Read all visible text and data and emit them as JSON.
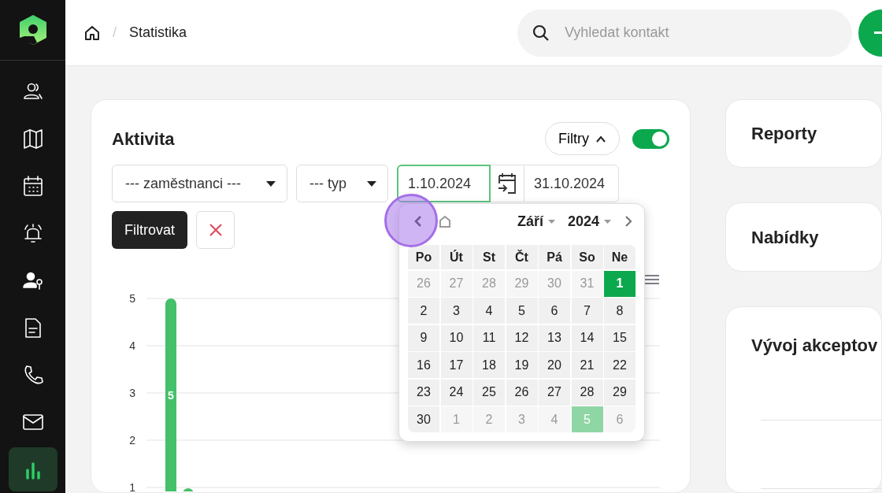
{
  "sidebar": {
    "items": [
      {
        "kind": "people",
        "selected": false
      },
      {
        "kind": "map",
        "selected": false
      },
      {
        "kind": "calendar",
        "selected": false
      },
      {
        "kind": "bell",
        "selected": false
      },
      {
        "kind": "user-key",
        "selected": false
      },
      {
        "kind": "document",
        "selected": false
      },
      {
        "kind": "phone",
        "selected": false
      },
      {
        "kind": "mail",
        "selected": false
      },
      {
        "kind": "chart",
        "selected": true
      }
    ]
  },
  "breadcrumb": {
    "separator": "/",
    "items": [
      "Statistika"
    ]
  },
  "search": {
    "placeholder": "Vyhledat kontakt"
  },
  "activity": {
    "title": "Aktivita",
    "filters_button": "Filtry",
    "filters_expanded": true,
    "toggle": {
      "on": true
    },
    "employee_select": "--- zaměstnanci ---",
    "type_select": "--- typ",
    "date_from": "1.10.2024",
    "date_to": "31.10.2024",
    "filter_button": "Filtrovat",
    "chart_data": {
      "type": "bar",
      "values": [
        5
      ],
      "ylim": [
        1,
        5
      ],
      "yticks": [
        1,
        2,
        3,
        4,
        5
      ],
      "grid": true,
      "value_labels": [
        "5"
      ]
    }
  },
  "datepicker": {
    "month": "Září",
    "year": "2024",
    "weekdays": [
      "Po",
      "Út",
      "St",
      "Čt",
      "Pá",
      "So",
      "Ne"
    ],
    "days": [
      {
        "label": "26",
        "muted": true,
        "selected": false,
        "today": false
      },
      {
        "label": "27",
        "muted": true,
        "selected": false,
        "today": false
      },
      {
        "label": "28",
        "muted": true,
        "selected": false,
        "today": false
      },
      {
        "label": "29",
        "muted": true,
        "selected": false,
        "today": false
      },
      {
        "label": "30",
        "muted": true,
        "selected": false,
        "today": false
      },
      {
        "label": "31",
        "muted": true,
        "selected": false,
        "today": false
      },
      {
        "label": "1",
        "muted": false,
        "selected": true,
        "today": false
      },
      {
        "label": "2",
        "muted": false,
        "selected": false,
        "today": false
      },
      {
        "label": "3",
        "muted": false,
        "selected": false,
        "today": false
      },
      {
        "label": "4",
        "muted": false,
        "selected": false,
        "today": false
      },
      {
        "label": "5",
        "muted": false,
        "selected": false,
        "today": false
      },
      {
        "label": "6",
        "muted": false,
        "selected": false,
        "today": false
      },
      {
        "label": "7",
        "muted": false,
        "selected": false,
        "today": false
      },
      {
        "label": "8",
        "muted": false,
        "selected": false,
        "today": false
      },
      {
        "label": "9",
        "muted": false,
        "selected": false,
        "today": false
      },
      {
        "label": "10",
        "muted": false,
        "selected": false,
        "today": false
      },
      {
        "label": "11",
        "muted": false,
        "selected": false,
        "today": false
      },
      {
        "label": "12",
        "muted": false,
        "selected": false,
        "today": false
      },
      {
        "label": "13",
        "muted": false,
        "selected": false,
        "today": false
      },
      {
        "label": "14",
        "muted": false,
        "selected": false,
        "today": false
      },
      {
        "label": "15",
        "muted": false,
        "selected": false,
        "today": false
      },
      {
        "label": "16",
        "muted": false,
        "selected": false,
        "today": false
      },
      {
        "label": "17",
        "muted": false,
        "selected": false,
        "today": false
      },
      {
        "label": "18",
        "muted": false,
        "selected": false,
        "today": false
      },
      {
        "label": "19",
        "muted": false,
        "selected": false,
        "today": false
      },
      {
        "label": "20",
        "muted": false,
        "selected": false,
        "today": false
      },
      {
        "label": "21",
        "muted": false,
        "selected": false,
        "today": false
      },
      {
        "label": "22",
        "muted": false,
        "selected": false,
        "today": false
      },
      {
        "label": "23",
        "muted": false,
        "selected": false,
        "today": false
      },
      {
        "label": "24",
        "muted": false,
        "selected": false,
        "today": false
      },
      {
        "label": "25",
        "muted": false,
        "selected": false,
        "today": false
      },
      {
        "label": "26",
        "muted": false,
        "selected": false,
        "today": false
      },
      {
        "label": "27",
        "muted": false,
        "selected": false,
        "today": false
      },
      {
        "label": "28",
        "muted": false,
        "selected": false,
        "today": false
      },
      {
        "label": "29",
        "muted": false,
        "selected": false,
        "today": false
      },
      {
        "label": "30",
        "muted": false,
        "selected": false,
        "today": false
      },
      {
        "label": "1",
        "muted": true,
        "selected": false,
        "today": false
      },
      {
        "label": "2",
        "muted": true,
        "selected": false,
        "today": false
      },
      {
        "label": "3",
        "muted": true,
        "selected": false,
        "today": false
      },
      {
        "label": "4",
        "muted": true,
        "selected": false,
        "today": false
      },
      {
        "label": "5",
        "muted": true,
        "selected": false,
        "today": true
      },
      {
        "label": "6",
        "muted": true,
        "selected": false,
        "today": false
      }
    ]
  },
  "side_cards": [
    {
      "title": "Reporty"
    },
    {
      "title": "Nabídky"
    },
    {
      "title": "Vývoj akceptov"
    }
  ]
}
